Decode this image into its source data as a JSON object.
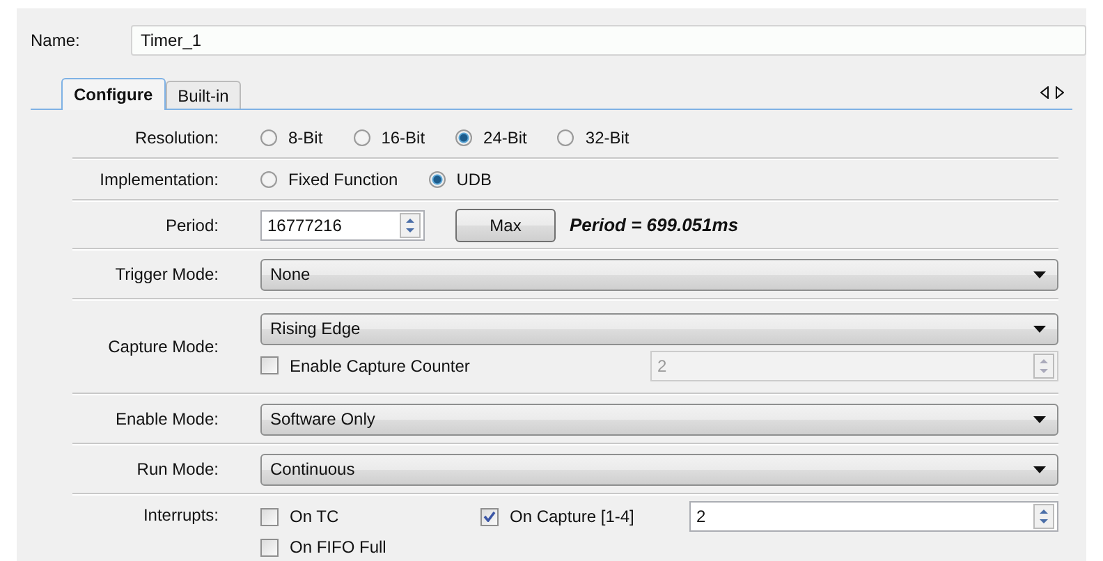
{
  "name_field": {
    "label": "Name:",
    "value": "Timer_1"
  },
  "tabs": [
    {
      "label": "Configure",
      "selected": true
    },
    {
      "label": "Built-in",
      "selected": false
    }
  ],
  "rows": [
    {
      "kind": "radio",
      "label": "Resolution:",
      "options": [
        {
          "label": "8-Bit",
          "selected": false
        },
        {
          "label": "16-Bit",
          "selected": false
        },
        {
          "label": "24-Bit",
          "selected": true
        },
        {
          "label": "32-Bit",
          "selected": false
        }
      ]
    },
    {
      "kind": "radio",
      "label": "Implementation:",
      "options": [
        {
          "label": "Fixed Function",
          "selected": false
        },
        {
          "label": "UDB",
          "selected": true
        }
      ]
    },
    {
      "kind": "period",
      "label": "Period:",
      "value": "16777216",
      "button": "Max",
      "result": "Period = 699.051ms"
    },
    {
      "kind": "dropdown",
      "label": "Trigger Mode:",
      "value": "None"
    },
    {
      "kind": "capture",
      "label": "Capture Mode:",
      "value": "Rising Edge",
      "checkbox": {
        "label": "Enable Capture Counter",
        "checked": false
      },
      "spinner": {
        "value": "2",
        "disabled": true
      }
    },
    {
      "kind": "dropdown",
      "label": "Enable Mode:",
      "value": "Software Only"
    },
    {
      "kind": "dropdown",
      "label": "Run Mode:",
      "value": "Continuous"
    },
    {
      "kind": "interrupts",
      "label": "Interrupts:",
      "checkboxes": [
        {
          "label": "On TC",
          "checked": false
        },
        {
          "label": "On Capture [1-4]",
          "checked": true
        },
        {
          "label": "On FIFO Full",
          "checked": false
        }
      ],
      "spinner": {
        "value": "2",
        "disabled": false
      }
    }
  ]
}
